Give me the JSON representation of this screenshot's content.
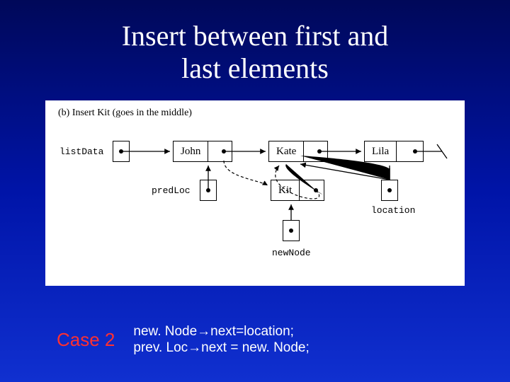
{
  "slide": {
    "title_line1": "Insert between first and",
    "title_line2": "last elements"
  },
  "diagram": {
    "caption": "(b) Insert Kit (goes in the middle)",
    "labels": {
      "listData": "listData",
      "predLoc": "predLoc",
      "newNode": "newNode",
      "location": "location"
    },
    "nodes": {
      "john": "John",
      "kate": "Kate",
      "lila": "Lila",
      "kit": "Kit"
    }
  },
  "footer": {
    "case": "Case 2",
    "line1": "new. Node→next=location;",
    "line2": "prev. Loc→next = new. Node;"
  }
}
